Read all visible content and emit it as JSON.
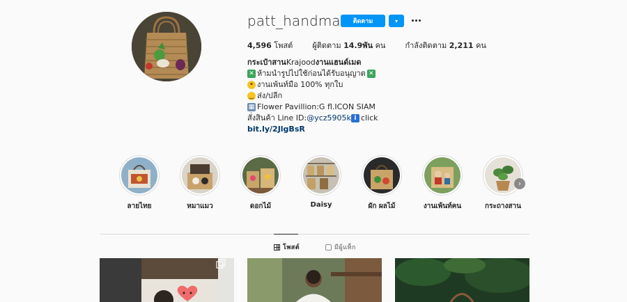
{
  "profile": {
    "username": "patt_handmade",
    "follow_label": "ติดตาม",
    "dropdown_icon": "▾",
    "stats": {
      "posts_count": "4,596",
      "posts_label": "โพสต์",
      "followers_label": "ผู้ติดตาม",
      "followers_count": "14.9พัน",
      "followers_unit": "คน",
      "following_label": "กำลังติดตาม",
      "following_count": "2,211",
      "following_unit": "คน"
    },
    "bio": {
      "name_bold": "กระเป๋าสาน",
      "name_rest": " Krajood ",
      "name_bold2": "งานแฮนด์เมด",
      "line1": "ห้ามนำรูปไปใช้ก่อนได้รับอนุญาต",
      "line2": "งานเพ้นท์มือ 100% ทุกใบ",
      "line3": "ส่ง/ปลีก",
      "line4": "Flower Pavillion:G fl.ICON SIAM",
      "line5_prefix": "สั่งสินค้า Line ID: ",
      "line5_mention": "@ycz5905k",
      "line5_suffix": "click",
      "link": "bit.ly/2JlgBsR"
    }
  },
  "highlights": [
    {
      "label": "ลายไทย",
      "icon": "handbag-photo"
    },
    {
      "label": "หมาแมว",
      "icon": "dog-bag-photo"
    },
    {
      "label": "ดอกไม้",
      "icon": "flower-bags-photo"
    },
    {
      "label": "Daisy",
      "icon": "shelf-bags-photo"
    },
    {
      "label": "ผัก ผลไม้",
      "icon": "veg-bag-photo"
    },
    {
      "label": "งานเพ้นท์คน",
      "icon": "person-painting-photo"
    },
    {
      "label": "กระถางสาน",
      "icon": "plant-pot-photo"
    }
  ],
  "tabs": [
    {
      "label": "โพสต์",
      "icon": "grid-icon",
      "active": true
    },
    {
      "label": "มีผู้แท็ก",
      "icon": "tagged-icon",
      "active": false
    }
  ],
  "colors": {
    "accent": "#0095f6",
    "link": "#00376b",
    "background": "#fafafa"
  }
}
